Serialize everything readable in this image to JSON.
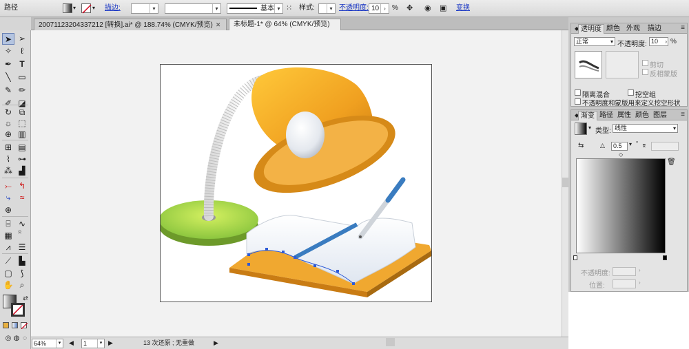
{
  "control_bar": {
    "object_type": "路径",
    "stroke_label": "描边:",
    "stroke_profile": "基本",
    "style_label": "样式:",
    "opacity_label": "不透明度:",
    "opacity_value": "10",
    "opacity_unit": "%",
    "transform_label": "变换"
  },
  "document_tabs": [
    {
      "label": "20071123204337212 [转换].ai* @ 188.74% (CMYK/预览)",
      "active": false
    },
    {
      "label": "未标题-1* @ 64% (CMYK/预览)",
      "active": true
    }
  ],
  "status_bar": {
    "zoom": "64%",
    "page": "1",
    "undo_status": "13 次还原 ; 无重做"
  },
  "transparency_panel": {
    "tabs": [
      "透明度",
      "颜色",
      "外观",
      "描边"
    ],
    "blend_mode": "正常",
    "opacity_label": "不透明度:",
    "opacity_value": "10",
    "opacity_unit": "%",
    "clip_label": "剪切",
    "invert_mask_label": "反相蒙版",
    "isolate_blending_label": "隔离混合",
    "knockout_group_label": "挖空组",
    "opacity_mask_label": "不透明度和蒙版用来定义挖空形状"
  },
  "gradient_panel": {
    "tabs": [
      "渐变",
      "路径",
      "属性",
      "颜色",
      "图层"
    ],
    "type_label": "类型:",
    "type_value": "线性",
    "angle_value": "0.5",
    "degree_unit": "°",
    "stop_opacity_label": "不透明度:",
    "stop_location_label": "位置:"
  },
  "colors": {
    "lamp_shade": "#f0a020",
    "lamp_base": "#8cc63f",
    "board": "#f0a830",
    "pencil_blue": "#3a7cc0",
    "selection": "#2e5bd6"
  }
}
